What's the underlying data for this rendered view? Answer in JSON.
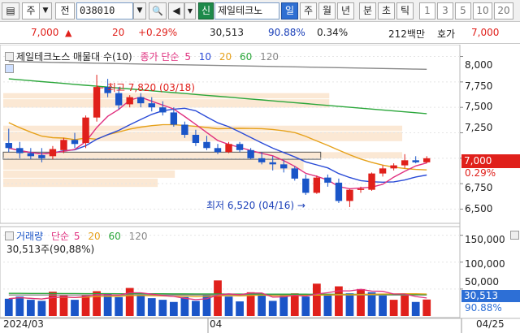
{
  "toolbar": {
    "menu_btn": "▤",
    "market_select": "주",
    "market_dd": "▼",
    "type_select": "전",
    "code_value": "038010",
    "code_dd": "▼",
    "search_icon": "🔍",
    "sound_icon": "◀",
    "sound_dd": "▼",
    "credit_label": "신",
    "stock_name": "제일테크노",
    "periods": [
      "일",
      "주",
      "월",
      "년",
      "분",
      "초",
      "틱"
    ],
    "active_period": "일",
    "intervals": [
      "1",
      "3",
      "5",
      "10",
      "20"
    ]
  },
  "quote": {
    "price": "7,000",
    "change_arrow": "▲",
    "change": "20",
    "change_pct": "+0.29%",
    "volume": "30,513",
    "vol_ratio": "90.88%",
    "turnover": "0.34%",
    "amount": "212백만",
    "ask_label": "호가",
    "ask_price": "7,000"
  },
  "legend": {
    "title": "제일테크노스 매물대 수(10)",
    "close_label": "종가 단순",
    "ma": [
      "5",
      "10",
      "20",
      "60",
      "120"
    ],
    "ma_colors": [
      "#e0307f",
      "#2a4bd7",
      "#e6a11a",
      "#2aa63a",
      "#888888"
    ],
    "volume_label": "거래량",
    "vol_ma_label": "단순",
    "vol_readout": "30,513주(90,88%)"
  },
  "annotations": {
    "high": "최고 7,820 (03/18)",
    "low": "최저 6,520 (04/16)"
  },
  "price_axis": {
    "ticks": [
      "8,000",
      "7,750",
      "7,500",
      "7,250",
      "7,000",
      "6,750",
      "6,500"
    ],
    "current_tag": "7,000",
    "current_pct": "0.29%"
  },
  "volume_axis": {
    "ticks": [
      "150,000",
      "100,000",
      "50,000"
    ],
    "current_tag": "30,513",
    "current_pct": "90.88%"
  },
  "date_axis": {
    "labels": [
      "2024/03",
      "04",
      "04/25"
    ]
  },
  "colors": {
    "up": "#e0201b",
    "down": "#1a55c8",
    "accent": "#2f6fd2",
    "brand_green": "#1d8a4a"
  },
  "chart_data": {
    "type": "candlestick",
    "ylim": [
      6400,
      8100
    ],
    "candles": [
      {
        "o": 7150,
        "h": 7290,
        "l": 7060,
        "c": 7100
      },
      {
        "o": 7100,
        "h": 7160,
        "l": 7000,
        "c": 7050
      },
      {
        "o": 7050,
        "h": 7100,
        "l": 6990,
        "c": 7020
      },
      {
        "o": 7030,
        "h": 7100,
        "l": 6960,
        "c": 7000
      },
      {
        "o": 7020,
        "h": 7120,
        "l": 6990,
        "c": 7090
      },
      {
        "o": 7080,
        "h": 7200,
        "l": 7050,
        "c": 7180
      },
      {
        "o": 7180,
        "h": 7250,
        "l": 7100,
        "c": 7140
      },
      {
        "o": 7150,
        "h": 7420,
        "l": 7100,
        "c": 7400
      },
      {
        "o": 7400,
        "h": 7820,
        "l": 7360,
        "c": 7700
      },
      {
        "o": 7700,
        "h": 7780,
        "l": 7600,
        "c": 7640
      },
      {
        "o": 7640,
        "h": 7700,
        "l": 7480,
        "c": 7520
      },
      {
        "o": 7530,
        "h": 7620,
        "l": 7500,
        "c": 7600
      },
      {
        "o": 7600,
        "h": 7640,
        "l": 7500,
        "c": 7540
      },
      {
        "o": 7540,
        "h": 7600,
        "l": 7460,
        "c": 7500
      },
      {
        "o": 7500,
        "h": 7560,
        "l": 7420,
        "c": 7450
      },
      {
        "o": 7450,
        "h": 7500,
        "l": 7310,
        "c": 7330
      },
      {
        "o": 7330,
        "h": 7360,
        "l": 7200,
        "c": 7230
      },
      {
        "o": 7230,
        "h": 7280,
        "l": 7120,
        "c": 7150
      },
      {
        "o": 7160,
        "h": 7220,
        "l": 7080,
        "c": 7100
      },
      {
        "o": 7100,
        "h": 7140,
        "l": 7040,
        "c": 7060
      },
      {
        "o": 7060,
        "h": 7160,
        "l": 7050,
        "c": 7140
      },
      {
        "o": 7140,
        "h": 7160,
        "l": 7060,
        "c": 7080
      },
      {
        "o": 7080,
        "h": 7100,
        "l": 6990,
        "c": 7000
      },
      {
        "o": 7000,
        "h": 7060,
        "l": 6940,
        "c": 6960
      },
      {
        "o": 6960,
        "h": 7020,
        "l": 6880,
        "c": 6940
      },
      {
        "o": 6940,
        "h": 6980,
        "l": 6860,
        "c": 6900
      },
      {
        "o": 6900,
        "h": 6920,
        "l": 6780,
        "c": 6800
      },
      {
        "o": 6800,
        "h": 6840,
        "l": 6640,
        "c": 6660
      },
      {
        "o": 6660,
        "h": 6830,
        "l": 6650,
        "c": 6810
      },
      {
        "o": 6810,
        "h": 6840,
        "l": 6720,
        "c": 6760
      },
      {
        "o": 6760,
        "h": 6800,
        "l": 6560,
        "c": 6580
      },
      {
        "o": 6580,
        "h": 6700,
        "l": 6520,
        "c": 6690
      },
      {
        "o": 6690,
        "h": 6720,
        "l": 6660,
        "c": 6700
      },
      {
        "o": 6690,
        "h": 6860,
        "l": 6680,
        "c": 6850
      },
      {
        "o": 6850,
        "h": 6930,
        "l": 6820,
        "c": 6900
      },
      {
        "o": 6900,
        "h": 6950,
        "l": 6880,
        "c": 6930
      },
      {
        "o": 6930,
        "h": 7040,
        "l": 6900,
        "c": 6980
      },
      {
        "o": 6980,
        "h": 7020,
        "l": 6950,
        "c": 6960
      },
      {
        "o": 6960,
        "h": 7020,
        "l": 6950,
        "c": 7000
      }
    ],
    "volume_ylim": [
      0,
      160000
    ],
    "volumes": [
      [
        32000,
        "d"
      ],
      [
        36000,
        "d"
      ],
      [
        30000,
        "d"
      ],
      [
        28000,
        "d"
      ],
      [
        45000,
        "u"
      ],
      [
        38000,
        "u"
      ],
      [
        30000,
        "d"
      ],
      [
        40000,
        "u"
      ],
      [
        46000,
        "u"
      ],
      [
        42000,
        "d"
      ],
      [
        35000,
        "d"
      ],
      [
        52000,
        "u"
      ],
      [
        40000,
        "d"
      ],
      [
        33000,
        "d"
      ],
      [
        30000,
        "d"
      ],
      [
        26000,
        "d"
      ],
      [
        35000,
        "d"
      ],
      [
        28000,
        "d"
      ],
      [
        40000,
        "d"
      ],
      [
        66000,
        "u"
      ],
      [
        36000,
        "d"
      ],
      [
        27000,
        "d"
      ],
      [
        44000,
        "u"
      ],
      [
        40000,
        "d"
      ],
      [
        28000,
        "d"
      ],
      [
        38000,
        "d"
      ],
      [
        42000,
        "u"
      ],
      [
        36000,
        "d"
      ],
      [
        60000,
        "u"
      ],
      [
        40000,
        "d"
      ],
      [
        55000,
        "u"
      ],
      [
        42000,
        "d"
      ],
      [
        50000,
        "u"
      ],
      [
        44000,
        "d"
      ],
      [
        38000,
        "d"
      ],
      [
        30000,
        "u"
      ],
      [
        42000,
        "u"
      ],
      [
        26000,
        "d"
      ],
      [
        30513,
        "u"
      ]
    ],
    "supply_zones": [
      {
        "from": 7580,
        "to": 7640,
        "len": 0.76
      },
      {
        "from": 7490,
        "to": 7580,
        "len": 0.76
      },
      {
        "from": 7260,
        "to": 7320,
        "len": 0.93
      },
      {
        "from": 7160,
        "to": 7260,
        "len": 0.93
      },
      {
        "from": 6990,
        "to": 7060,
        "len": 0.93
      },
      {
        "from": 6880,
        "to": 6990,
        "len": 0.7
      },
      {
        "from": 6800,
        "to": 6880,
        "len": 0.4
      },
      {
        "from": 6710,
        "to": 6800,
        "len": 0.36
      }
    ]
  }
}
